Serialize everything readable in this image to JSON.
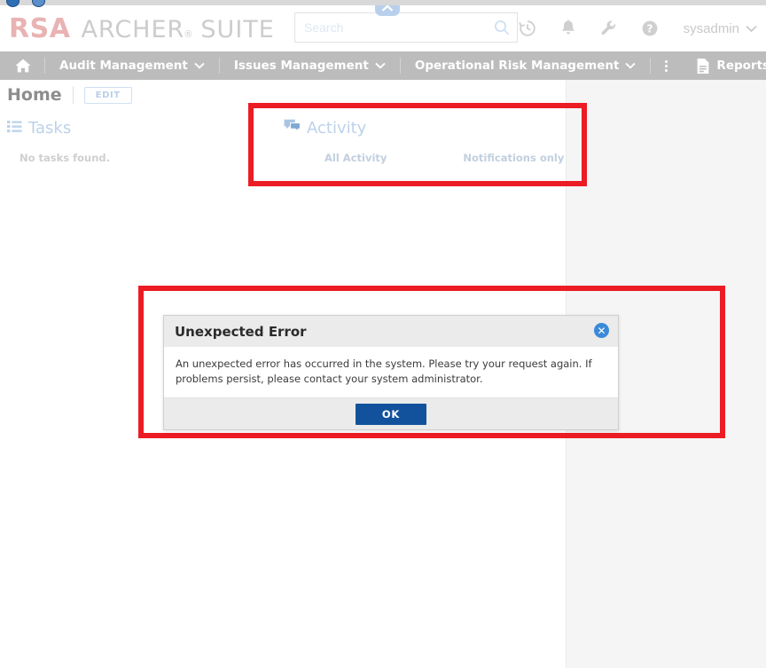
{
  "window": {
    "top_stub_icons": [
      "browser-icon-1",
      "browser-icon-2"
    ]
  },
  "header": {
    "logo": {
      "rsa": "RSA",
      "archer": "ARCHER",
      "registered": "®",
      "suite": "SUITE"
    },
    "search": {
      "placeholder": "Search",
      "value": "",
      "icon": "search-icon"
    },
    "collapse_tab": {
      "icon": "chevron-up-icon"
    },
    "icons": [
      {
        "name": "recent-history-icon",
        "glyph": "history"
      },
      {
        "name": "notifications-bell-icon",
        "glyph": "bell"
      },
      {
        "name": "tools-wrench-icon",
        "glyph": "wrench"
      },
      {
        "name": "help-icon",
        "glyph": "question-circle"
      }
    ],
    "user": {
      "label": "sysadmin",
      "chevron": "chevron-down-icon"
    }
  },
  "nav": {
    "home_icon": "home-icon",
    "items": [
      {
        "label": "Audit Management",
        "chevron": "chevron-down-icon"
      },
      {
        "label": "Issues Management",
        "chevron": "chevron-down-icon"
      },
      {
        "label": "Operational Risk Management",
        "chevron": "chevron-down-icon"
      }
    ],
    "overflow_icon": "kebab-menu-icon",
    "reports": {
      "label": "Reports",
      "icon": "report-document-icon"
    }
  },
  "breadcrumb": {
    "title": "Home",
    "edit_label": "EDIT"
  },
  "panels": {
    "tasks": {
      "title": "Tasks",
      "icon": "task-list-icon",
      "empty_text": "No tasks found."
    },
    "activity": {
      "title": "Activity",
      "icon": "activity-chat-icon",
      "tabs": [
        {
          "label": "All Activity"
        },
        {
          "label": "Notifications only"
        }
      ]
    }
  },
  "dialog": {
    "title": "Unexpected Error",
    "message": "An unexpected error has occurred in the system. Please try your request again. If problems persist, please contact your system administrator.",
    "ok_label": "OK",
    "close_icon": "close-icon"
  },
  "highlights": [
    {
      "name": "activity-panel-highlight"
    },
    {
      "name": "error-dialog-highlight"
    }
  ],
  "colors": {
    "logo_red": "#e9b3b3",
    "nav_gray": "#bcbcbc",
    "accent_blue": "#12529c",
    "close_blue": "#3b8ad9",
    "highlight_red": "#ec1c24",
    "panel_heading_blue": "#bcd2ea",
    "page_bg": "#f5f5f5"
  }
}
